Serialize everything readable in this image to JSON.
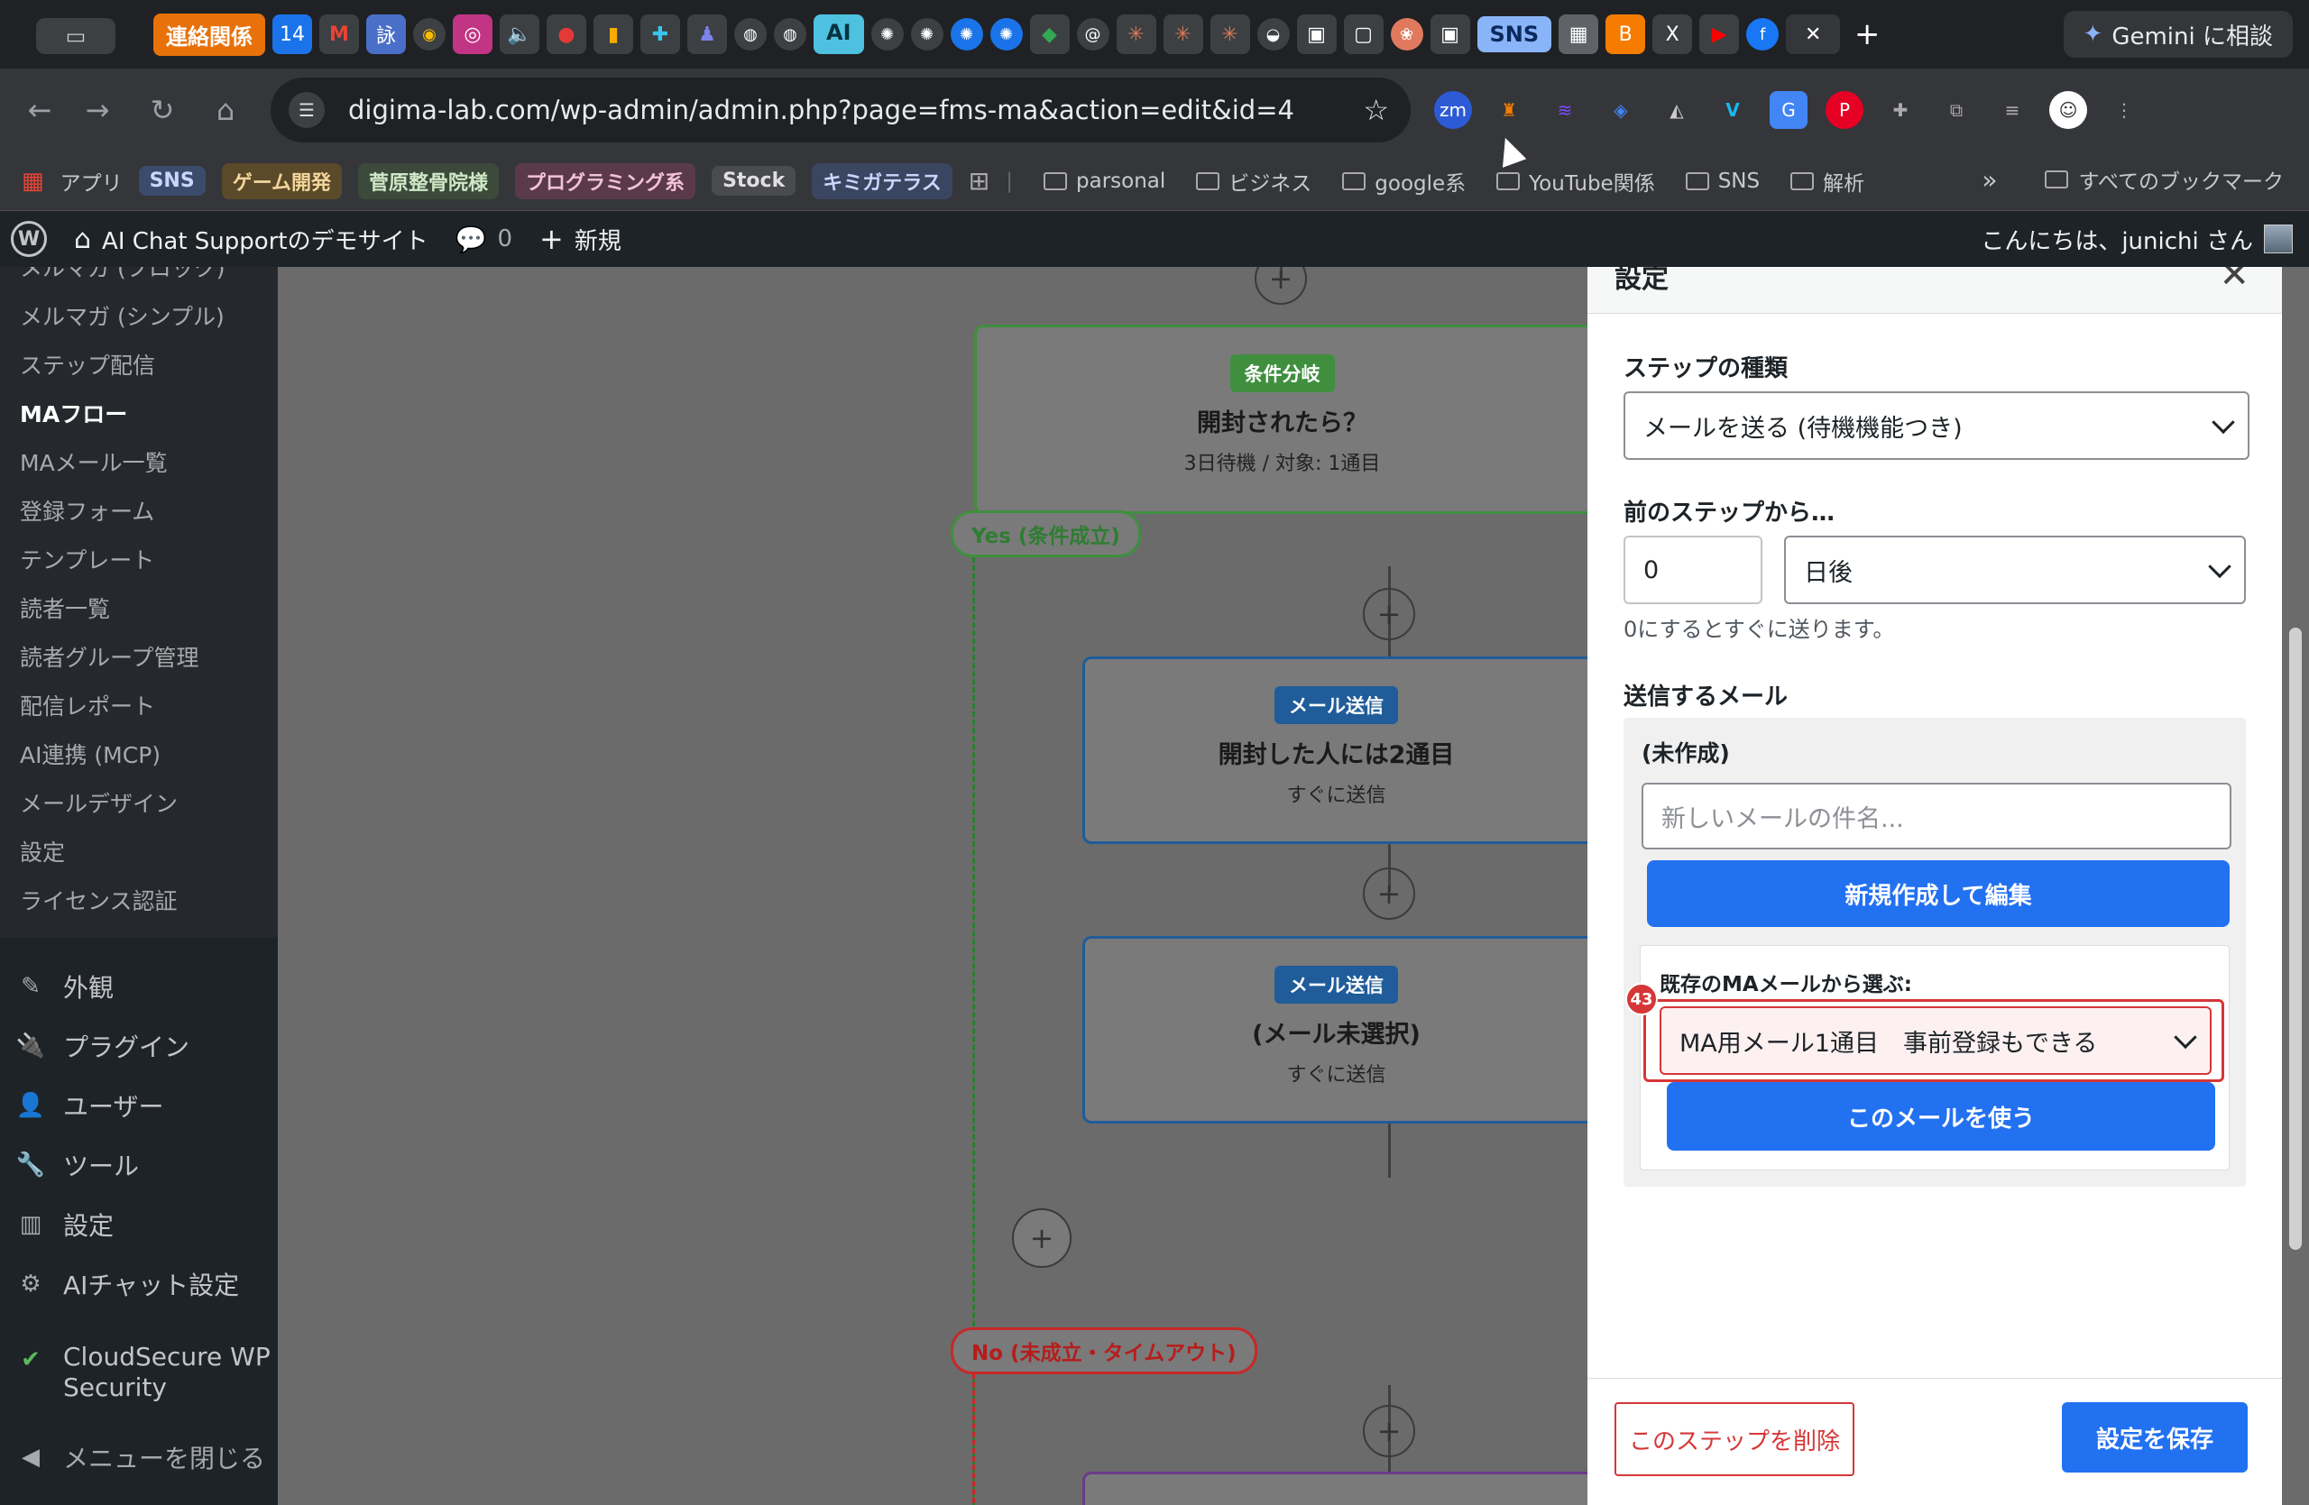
{
  "tabs": {
    "group_label": "連絡関係",
    "sns_group_label": "SNS",
    "ai_label": "AI",
    "icons": [
      "calendar-icon",
      "gmail-icon",
      "kanji-icon",
      "chrome-icon",
      "instagram-icon",
      "audio-icon",
      "cluster-icon",
      "chart-icon",
      "slack-icon",
      "teams-icon",
      "globe-icon",
      "globe-icon",
      "openai-icon",
      "openai-icon",
      "openai-icon",
      "openai-icon",
      "drive-icon",
      "threads-icon",
      "claude-icon",
      "claude-icon",
      "claude-icon",
      "notion-icon",
      "note-icon",
      "doc-icon",
      "color-icon",
      "note-icon"
    ],
    "calendar_day": "14",
    "gemini_label": "Gemini に相談"
  },
  "toolbar": {
    "url": "digima-lab.com/wp-admin/admin.php?page=fms-ma&action=edit&id=4",
    "zm_label": "zm"
  },
  "bookmarks": {
    "apps_label": "アプリ",
    "chips": [
      {
        "label": "SNS",
        "bg": "#3b4b6b",
        "fg": "#c9d6ff"
      },
      {
        "label": "ゲーム開発",
        "bg": "#5b4a2a",
        "fg": "#f2d59a"
      },
      {
        "label": "菅原整骨院様",
        "bg": "#3b4a3a",
        "fg": "#cfe8c6"
      },
      {
        "label": "プログラミング系",
        "bg": "#5a3a4a",
        "fg": "#f2c2d8"
      },
      {
        "label": "Stock",
        "bg": "#4a4b4f",
        "fg": "#e0e0e0"
      },
      {
        "label": "キミガテラス",
        "bg": "#3a4560",
        "fg": "#c9d6ff"
      }
    ],
    "folders": [
      "parsonal",
      "ビジネス",
      "google系",
      "YouTube関係",
      "SNS",
      "解析"
    ],
    "more": "»",
    "all_bookmarks": "すべてのブックマーク"
  },
  "adminbar": {
    "site_name": "AI Chat Supportのデモサイト",
    "comments": "0",
    "new_label": "新規",
    "greeting": "こんにちは、junichi さん"
  },
  "sidebar": {
    "sub_items": [
      {
        "label": "メルマガ (ブロック)",
        "active": false
      },
      {
        "label": "メルマガ (シンプル)",
        "active": false
      },
      {
        "label": "ステップ配信",
        "active": false
      },
      {
        "label": "MAフロー",
        "active": true
      },
      {
        "label": "MAメール一覧",
        "active": false
      },
      {
        "label": "登録フォーム",
        "active": false
      },
      {
        "label": "テンプレート",
        "active": false
      },
      {
        "label": "読者一覧",
        "active": false
      },
      {
        "label": "読者グループ管理",
        "active": false
      },
      {
        "label": "配信レポート",
        "active": false
      },
      {
        "label": "AI連携 (MCP)",
        "active": false
      },
      {
        "label": "メールデザイン",
        "active": false
      },
      {
        "label": "設定",
        "active": false
      },
      {
        "label": "ライセンス認証",
        "active": false
      }
    ],
    "main_items": [
      {
        "label": "外観",
        "icon": "brush-icon"
      },
      {
        "label": "プラグイン",
        "icon": "plugin-icon"
      },
      {
        "label": "ユーザー",
        "icon": "user-icon"
      },
      {
        "label": "ツール",
        "icon": "wrench-icon"
      },
      {
        "label": "設定",
        "icon": "settings-icon"
      },
      {
        "label": "AIチャット設定",
        "icon": "gear-icon"
      },
      {
        "label": "CloudSecure WP Security",
        "icon": "shield-icon"
      },
      {
        "label": "メニューを閉じる",
        "icon": "collapse-icon"
      }
    ]
  },
  "canvas": {
    "condition_node": {
      "badge": "条件分岐",
      "title": "開封されたら？",
      "sub": "3日待機 / 対象: 1通目"
    },
    "yes_label": "Yes (条件成立)",
    "mail_node_1": {
      "badge": "メール送信",
      "title": "開封した人には2通目",
      "sub": "すぐに送信"
    },
    "mail_node_2": {
      "badge": "メール送信",
      "title": "(メール未選択)",
      "sub": "すぐに送信"
    },
    "no_label": "No (未成立・タイムアウト)",
    "colors": {
      "green": "#4caf50",
      "blue": "#2271b1",
      "red": "#d63638",
      "purple": "#8e44ad"
    }
  },
  "panel": {
    "title": "設定",
    "step_type_label": "ステップの種類",
    "step_type_value": "メールを送る (待機機能つき)",
    "from_prev_label": "前のステップから…",
    "delay_value": "0",
    "delay_unit": "日後",
    "delay_hint": "0にするとすぐに送ります。",
    "send_mail_label": "送信するメール",
    "mail_status": "(未作成)",
    "subject_placeholder": "新しいメールの件名...",
    "create_btn": "新規作成して編集",
    "existing_label": "既存のMAメールから選ぶ:",
    "existing_value": "MA用メール1通目　事前登録もできる",
    "error_count": "43",
    "use_btn": "このメールを使う",
    "delete_btn": "このステップを削除",
    "save_btn": "設定を保存"
  }
}
